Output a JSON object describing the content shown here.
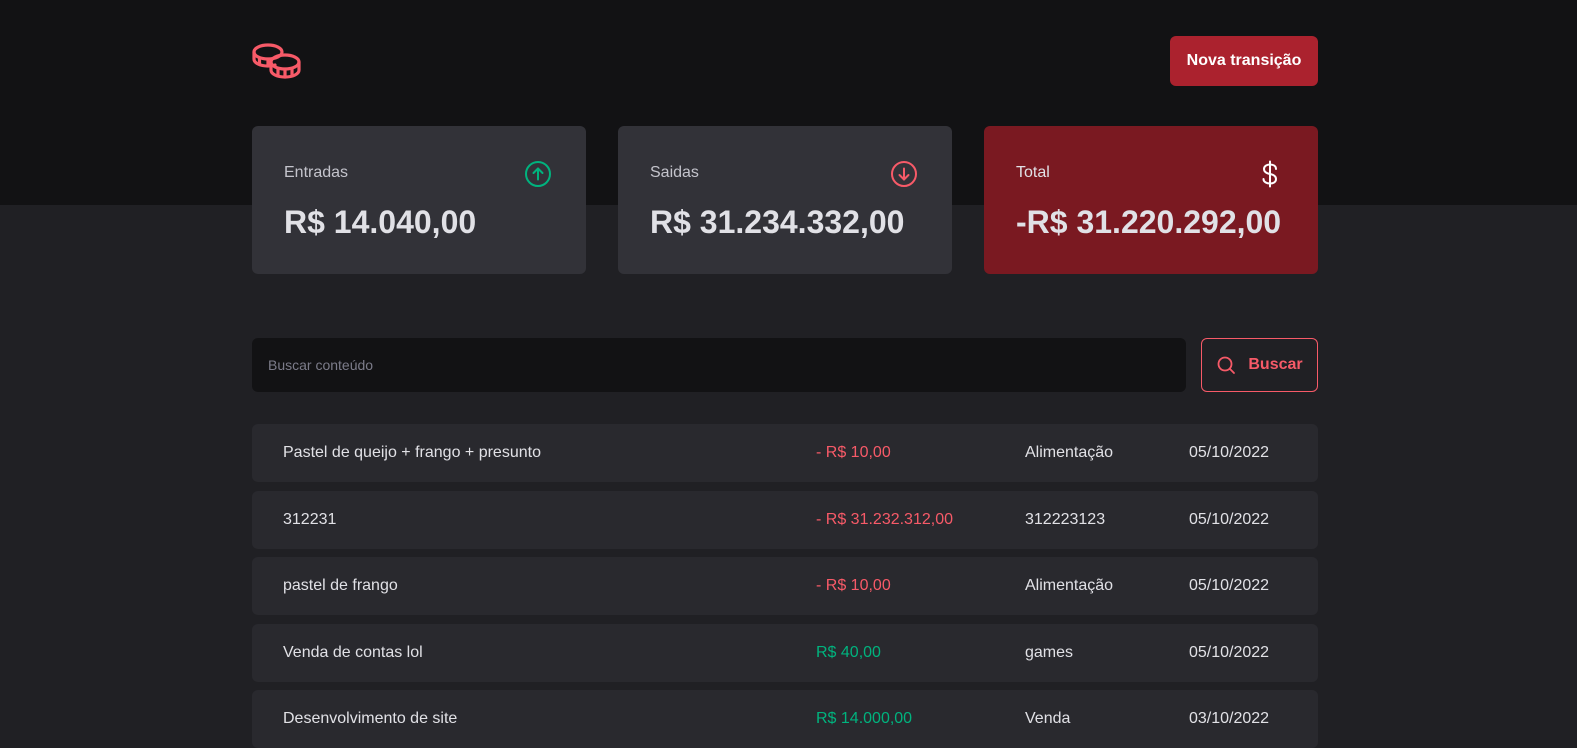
{
  "header": {
    "logo_icon": "coins-icon",
    "new_transaction_label": "Nova transição",
    "accent": "#ab222e"
  },
  "summary": {
    "income": {
      "label": "Entradas",
      "value": "R$ 14.040,00",
      "icon": "arrow-circle-up-icon",
      "icon_color": "#00b37e"
    },
    "outcome": {
      "label": "Saidas",
      "value": "R$ 31.234.332,00",
      "icon": "arrow-circle-down-icon",
      "icon_color": "#f75a68"
    },
    "total": {
      "label": "Total",
      "value": "-R$ 31.220.292,00",
      "icon": "currency-dollar-icon",
      "background": "#7a1921"
    }
  },
  "search": {
    "placeholder": "Buscar conteúdo",
    "value": "",
    "button_label": "Buscar"
  },
  "transactions": [
    {
      "description": "Pastel de queijo + frango + presunto",
      "price": "- R$ 10,00",
      "type": "out",
      "category": "Alimentação",
      "date": "05/10/2022"
    },
    {
      "description": "312231",
      "price": "- R$ 31.232.312,00",
      "type": "out",
      "category": "312223123",
      "date": "05/10/2022"
    },
    {
      "description": "pastel de frango",
      "price": "- R$ 10,00",
      "type": "out",
      "category": "Alimentação",
      "date": "05/10/2022"
    },
    {
      "description": "Venda de contas lol",
      "price": "R$ 40,00",
      "type": "in",
      "category": "games",
      "date": "05/10/2022"
    },
    {
      "description": "Desenvolvimento de site",
      "price": "R$ 14.000,00",
      "type": "in",
      "category": "Venda",
      "date": "03/10/2022"
    }
  ]
}
